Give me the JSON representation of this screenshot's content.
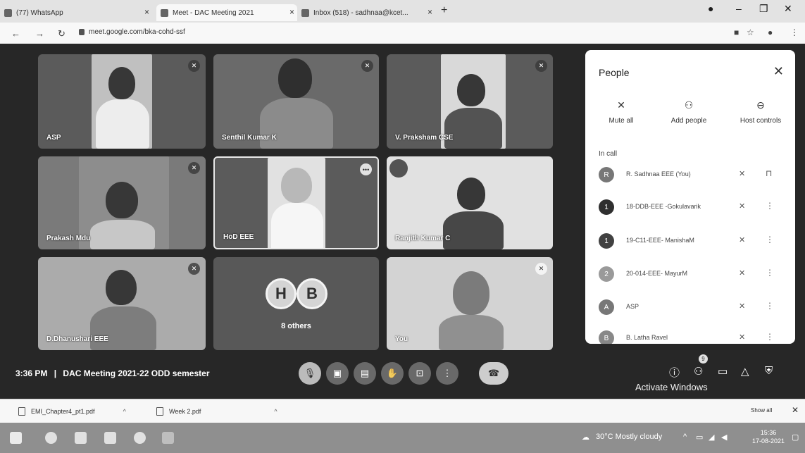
{
  "browser": {
    "tabs": [
      {
        "title": "(77) WhatsApp"
      },
      {
        "title": "Meet - DAC Meeting 2021"
      },
      {
        "title": "Inbox (518) - sadhnaa@kcet..."
      }
    ],
    "url": "meet.google.com/bka-cohd-ssf"
  },
  "meeting": {
    "time": "3:36 PM",
    "separator": "|",
    "title": "DAC Meeting 2021-22 ODD semester",
    "tiles": [
      {
        "name": "ASP"
      },
      {
        "name": "Senthil Kumar K"
      },
      {
        "name": "V. Praksham CSE"
      },
      {
        "name": "Prakash Mdu"
      },
      {
        "name": "HoD EEE"
      },
      {
        "name": "Ranjith Kumar C"
      },
      {
        "name": "D.Dhanushari EEE"
      },
      {
        "name": "8 others",
        "avatars": [
          "H",
          "B"
        ]
      },
      {
        "name": "You"
      }
    ],
    "activate_windows": "Activate Windows",
    "participant_badge": "9"
  },
  "people_panel": {
    "title": "People",
    "actions": [
      {
        "label": "Mute all",
        "icon": "mic-off-icon"
      },
      {
        "label": "Add people",
        "icon": "add-person-icon"
      },
      {
        "label": "Host controls",
        "icon": "toggle-icon"
      }
    ],
    "section": "In call",
    "participants": [
      {
        "name": "R. Sadhnaa EEE (You)",
        "initial": "R"
      },
      {
        "name": "18-DDB-EEE -Gokulavarik",
        "initial": "1"
      },
      {
        "name": "19-C11-EEE- ManishaM",
        "initial": "1"
      },
      {
        "name": "20-014-EEE- MayurM",
        "initial": "2"
      },
      {
        "name": "ASP",
        "initial": "A"
      },
      {
        "name": "B. Latha Ravel",
        "initial": "B"
      }
    ]
  },
  "downloads": {
    "items": [
      "EMI_Chapter4_pt1.pdf",
      "Week 2.pdf"
    ],
    "show_all": "Show all"
  },
  "taskbar": {
    "weather": "30°C  Mostly cloudy",
    "time": "15:36",
    "date": "17-08-2021"
  }
}
